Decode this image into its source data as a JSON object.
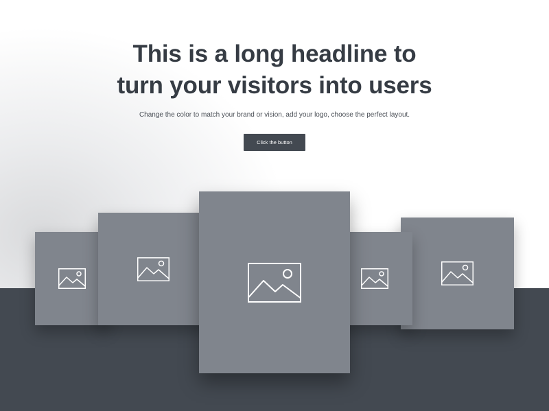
{
  "hero": {
    "headline_line1": "This is a long headline to",
    "headline_line2": "turn your visitors into users",
    "subtitle": "Change the color to match your brand or vision, add your logo, choose the perfect layout.",
    "button_label": "Click the button"
  },
  "gallery": {
    "items": [
      {
        "icon": "image-placeholder-icon"
      },
      {
        "icon": "image-placeholder-icon"
      },
      {
        "icon": "image-placeholder-icon"
      },
      {
        "icon": "image-placeholder-icon"
      },
      {
        "icon": "image-placeholder-icon"
      }
    ]
  },
  "colors": {
    "background": "#ffffff",
    "bottom_band": "#434951",
    "card": "#80858d",
    "headline": "#363c44",
    "button": "#434951",
    "button_text": "#ffffff",
    "icon_stroke": "#ffffff"
  }
}
